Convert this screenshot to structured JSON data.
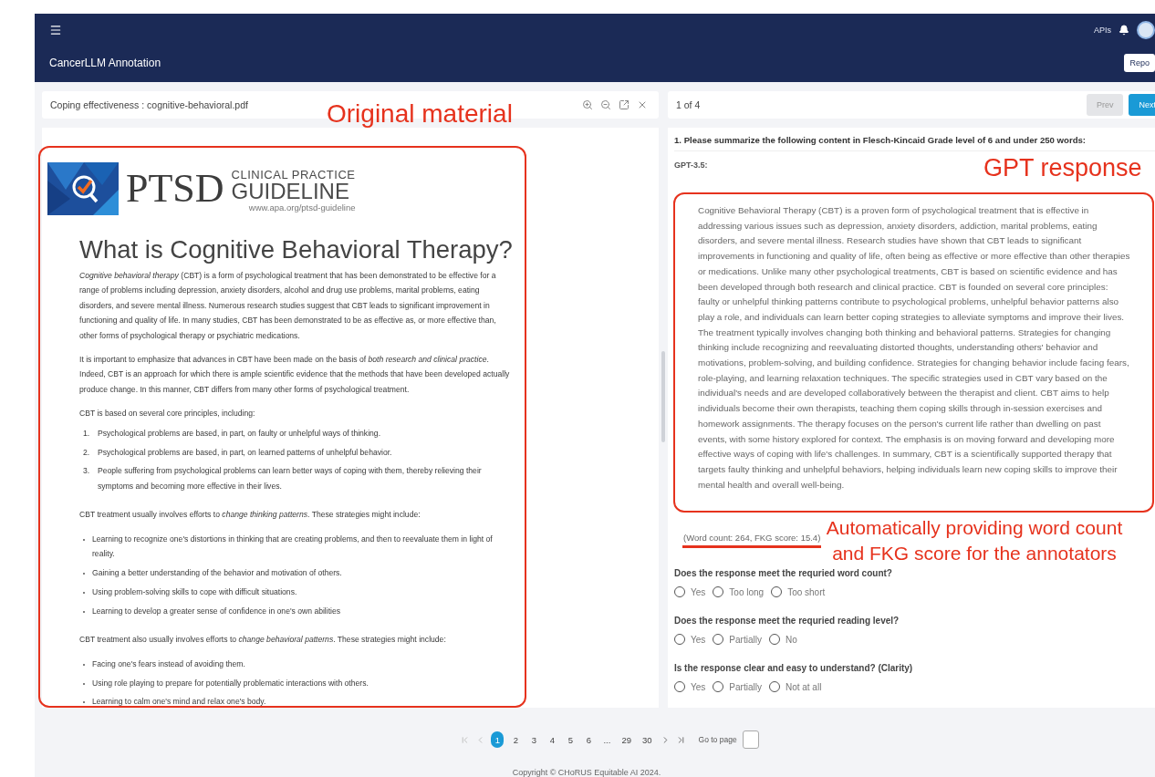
{
  "app": {
    "title": "CancerLLM Annotation",
    "nav_link": "APIs",
    "report_button": "Repo"
  },
  "document_panel": {
    "title": "Coping effectiveness : cognitive-behavioral.pdf",
    "document": {
      "logo_word": "PTSD",
      "logo_line_1": "CLINICAL PRACTICE",
      "logo_line_2": "GUIDELINE",
      "logo_url": "www.apa.org/ptsd-guideline",
      "heading": "What is Cognitive Behavioral Therapy?",
      "blocks": [
        {
          "kind": "paragraph",
          "text": "*Cognitive behavioral therapy* (CBT) is a form of psychological treatment that has been demonstrated to be effective for a range of problems including depression, anxiety disorders, alcohol and drug use problems, marital problems, eating disorders, and severe mental illness. Numerous research studies suggest that CBT leads to significant improvement in functioning and quality of life. In many studies, CBT has been demonstrated to be as effective as, or more effective than, other forms of psychological therapy or psychiatric medications."
        },
        {
          "kind": "paragraph",
          "text": "It is important to emphasize that advances in CBT have been made on the basis of *both research and clinical practice*. Indeed, CBT is an approach for which there is ample scientific evidence that the methods that have been developed actually produce change. In this manner, CBT differs from many other forms of psychological treatment."
        },
        {
          "kind": "paragraph",
          "text": "CBT is based on several core principles, including:"
        },
        {
          "kind": "numbered",
          "items": [
            {
              "number": "1.",
              "text": "Psychological problems are based, in part, on faulty or unhelpful ways of thinking."
            },
            {
              "number": "2.",
              "text": "Psychological problems are based, in part, on learned patterns of unhelpful behavior."
            },
            {
              "number": "3.",
              "text": "People suffering from psychological problems can learn better ways of coping with them, thereby relieving their symptoms and becoming more effective in their lives."
            }
          ]
        },
        {
          "kind": "paragraph",
          "text": "CBT treatment usually involves efforts to *change thinking patterns*. These strategies might include:"
        },
        {
          "kind": "bullets",
          "items": [
            {
              "text": "Learning to recognize one's distortions in thinking that are creating problems, and then to reevaluate them in light of reality."
            },
            {
              "text": "Gaining a better understanding of the behavior and motivation of others."
            },
            {
              "text": "Using problem-solving skills to cope with difficult situations."
            },
            {
              "text": "Learning to develop a greater sense of confidence in one's own abilities"
            }
          ]
        },
        {
          "kind": "paragraph",
          "text": "CBT treatment also usually involves efforts to *change behavioral patterns*. These strategies might include:"
        },
        {
          "kind": "bullets",
          "items": [
            {
              "text": "Facing one's fears instead of avoiding them."
            },
            {
              "text": "Using role playing to prepare for potentially problematic interactions with others."
            },
            {
              "text": "Learning to calm one's mind and relax one's body."
            }
          ]
        }
      ]
    }
  },
  "task_panel": {
    "position": "1 of 4",
    "prev_button": "Prev",
    "next_button": "Next",
    "prompt": "1. Please summarize the following content in Flesch-Kincaid Grade level of 6 and under 250 words:",
    "model": "GPT-3.5:",
    "response": "Cognitive Behavioral Therapy (CBT) is a proven form of psychological treatment that is effective in addressing various issues such as depression, anxiety disorders, addiction, marital problems, eating disorders, and severe mental illness. Research studies have shown that CBT leads to significant improvements in functioning and quality of life, often being as effective or more effective than other therapies or medications. Unlike many other psychological treatments, CBT is based on scientific evidence and has been developed through both research and clinical practice. CBT is founded on several core principles: faulty or unhelpful thinking patterns contribute to psychological problems, unhelpful behavior patterns also play a role, and individuals can learn better coping strategies to alleviate symptoms and improve their lives. The treatment typically involves changing both thinking and behavioral patterns. Strategies for changing thinking include recognizing and reevaluating distorted thoughts, understanding others' behavior and motivations, problem-solving, and building confidence. Strategies for changing behavior include facing fears, role-playing, and learning relaxation techniques. The specific strategies used in CBT vary based on the individual's needs and are developed collaboratively between the therapist and client. CBT aims to help individuals become their own therapists, teaching them coping skills through in-session exercises and homework assignments. The therapy focuses on the person's current life rather than dwelling on past events, with some history explored for context. The emphasis is on moving forward and developing more effective ways of coping with life's challenges. In summary, CBT is a scientifically supported therapy that targets faulty thinking and unhelpful behaviors, helping individuals learn new coping skills to improve their mental health and overall well-being.",
    "metrics": "(Word count: 264, FKG score: 15.4)",
    "questions": [
      {
        "text": "Does the response meet the requried word count?",
        "options": [
          {
            "label": "Yes",
            "selected": false
          },
          {
            "label": "Too long",
            "selected": false
          },
          {
            "label": "Too short",
            "selected": false
          }
        ]
      },
      {
        "text": "Does the response meet the requried reading level?",
        "options": [
          {
            "label": "Yes",
            "selected": false
          },
          {
            "label": "Partially",
            "selected": false
          },
          {
            "label": "No",
            "selected": false
          }
        ]
      },
      {
        "text": "Is the response clear and easy to understand? (Clarity)",
        "options": [
          {
            "label": "Yes",
            "selected": false
          },
          {
            "label": "Partially",
            "selected": false
          },
          {
            "label": "Not at all",
            "selected": false
          }
        ]
      }
    ]
  },
  "pagination": {
    "pages": [
      {
        "label": "1",
        "selected": true
      },
      {
        "label": "2",
        "selected": false
      },
      {
        "label": "3",
        "selected": false
      },
      {
        "label": "4",
        "selected": false
      },
      {
        "label": "5",
        "selected": false
      },
      {
        "label": "6",
        "selected": false
      },
      {
        "label": "...",
        "selected": false
      },
      {
        "label": "29",
        "selected": false
      },
      {
        "label": "30",
        "selected": false
      }
    ],
    "goto_label": "Go to page"
  },
  "footer": "Copyright © CHoRUS Equitable AI 2024.",
  "annotations": {
    "source_label": "Original material",
    "response_label": "GPT response",
    "metrics_note": "Automatically providing word count and FKG score for the annotators"
  }
}
